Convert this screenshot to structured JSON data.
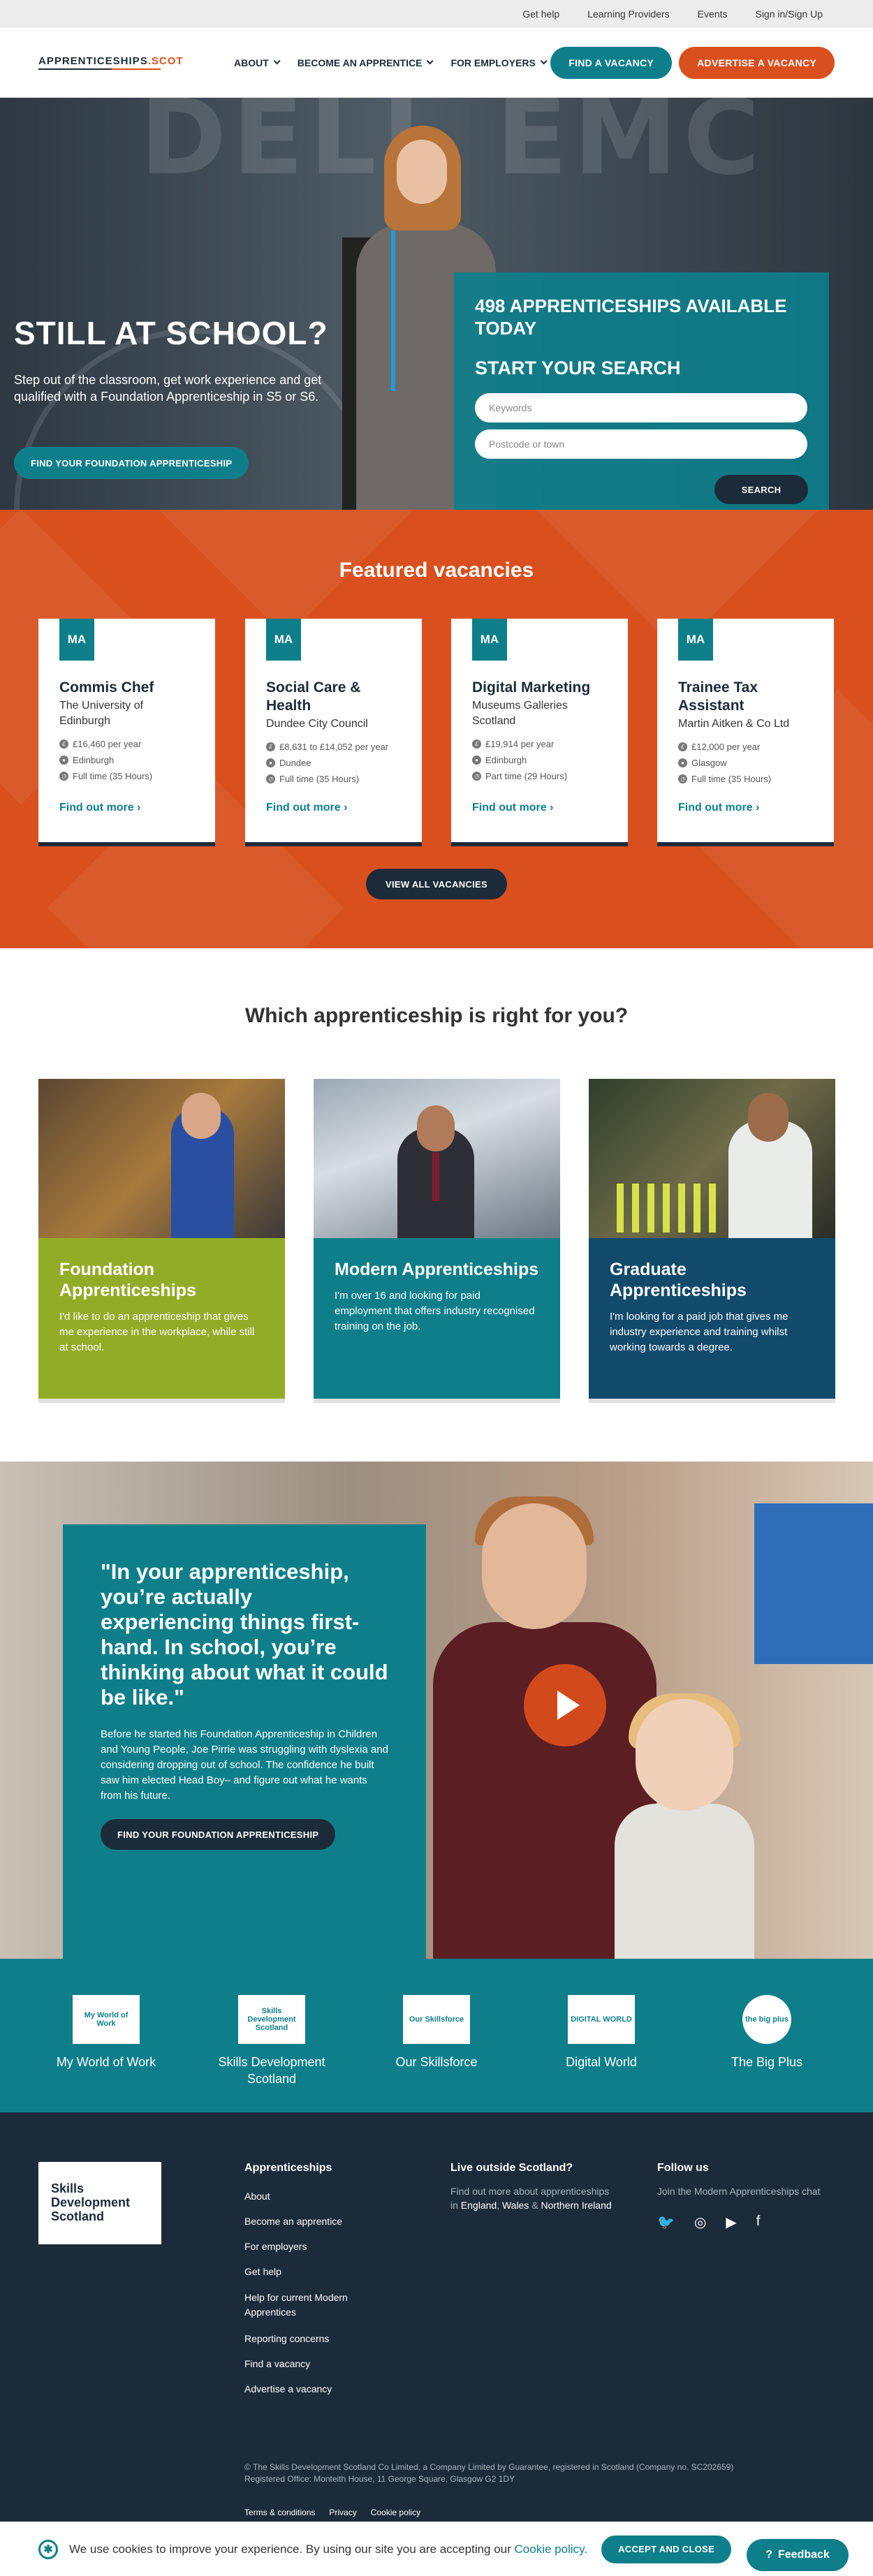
{
  "util_nav": [
    "Get help",
    "Learning Providers",
    "Events",
    "Sign in/Sign Up"
  ],
  "logo": {
    "main_a": "APPRENTICESHIPS",
    "main_b": ".SCOT"
  },
  "nav": [
    "About",
    "Become an apprentice",
    "For employers"
  ],
  "header_buttons": {
    "find": "FIND A VACANCY",
    "advertise": "ADVERTISE A VACANCY"
  },
  "hero": {
    "bg_text": "DELL EMC",
    "title": "STILL AT SCHOOL?",
    "subtitle": "Step out of the classroom, get work experience and get qualified with a Foundation Apprenticeship in S5 or S6.",
    "cta": "FIND YOUR FOUNDATION APPRENTICESHIP"
  },
  "search": {
    "count_text": "498 APPRENTICESHIPS AVAILABLE TODAY",
    "heading": "START YOUR SEARCH",
    "keywords_placeholder": "Keywords",
    "postcode_placeholder": "Postcode or town",
    "button": "SEARCH"
  },
  "featured": {
    "heading": "Featured vacancies",
    "badge": "MA",
    "more": "Find out more ›",
    "view_all": "VIEW ALL VACANCIES",
    "items": [
      {
        "title": "Commis Chef",
        "org": "The University of Edinburgh",
        "pay": "£16,460 per year",
        "location": "Edinburgh",
        "hours": "Full time (35 Hours)"
      },
      {
        "title": "Social Care & Health",
        "org": "Dundee City Council",
        "pay": "£8,631 to £14,052 per year",
        "location": "Dundee",
        "hours": "Full time (35 Hours)"
      },
      {
        "title": "Digital Marketing",
        "org": "Museums Galleries Scotland",
        "pay": "£19,914 per year",
        "location": "Edinburgh",
        "hours": "Part time (29 Hours)"
      },
      {
        "title": "Trainee Tax Assistant",
        "org": "Martin Aitken & Co Ltd",
        "pay": "£12,000 per year",
        "location": "Glasgow",
        "hours": "Full time (35 Hours)"
      }
    ]
  },
  "which": {
    "heading": "Which apprenticeship is right for you?",
    "cards": [
      {
        "title": "Foundation Apprenticeships",
        "text": "I'd like to do an apprenticeship that gives me experience in the workplace, while still at school.",
        "color": "#93ac27"
      },
      {
        "title": "Modern Apprenticeships",
        "text": "I'm over 16 and looking for paid employment that offers industry recognised training on the job.",
        "color": "#0e7f8a"
      },
      {
        "title": "Graduate Apprenticeships",
        "text": "I'm looking for a paid job that gives me industry experience and training whilst working towards a degree.",
        "color": "#124a6b"
      }
    ]
  },
  "quote": {
    "text": "\"In your apprenticeship, you’re actually experiencing things first-hand. In school, you’re thinking about what it could be like.\"",
    "body": "Before he started his Foundation Apprenticeship in Children and Young People, Joe Pirrie was struggling with dyslexia and considering dropping out of school. The confidence he built saw him elected Head Boy– and figure out what he wants from his future.",
    "cta": "FIND YOUR FOUNDATION APPRENTICESHIP"
  },
  "partners": [
    {
      "label": "My World of Work",
      "logo": "My World of Work"
    },
    {
      "label": "Skills Development Scotland",
      "logo": "Skills Development Scotland"
    },
    {
      "label": "Our Skillsforce",
      "logo": "Our Skillsforce"
    },
    {
      "label": "Digital World",
      "logo": "DIGITAL WORLD"
    },
    {
      "label": "The Big Plus",
      "logo": "the big plus"
    }
  ],
  "footer": {
    "logo": "Skills Development Scotland",
    "col1_title": "Apprenticeships",
    "col1_links": [
      "About",
      "Become an apprentice",
      "For employers",
      "Get help",
      "Help for current Modern Apprentices",
      "Reporting concerns",
      "Find a vacancy",
      "Advertise a vacancy"
    ],
    "col2_title": "Live outside Scotland?",
    "col2_text_a": "Find out more about apprenticeships in ",
    "col2_links": [
      "England",
      "Wales",
      "Northern Ireland"
    ],
    "col3_title": "Follow us",
    "col3_text": "Join the Modern Apprenticeships chat",
    "social_icons": [
      "twitter-icon",
      "instagram-icon",
      "youtube-icon",
      "facebook-icon"
    ],
    "copyright": "© The Skills Development Scotland Co Limited, a Company Limited by Guarantee, registered in Scotland (Company no. SC202659) Registered Office: Monteith House, 11 George Square, Glasgow G2 1DY",
    "legal": [
      "Terms & conditions",
      "Privacy",
      "Cookie policy"
    ]
  },
  "cookie": {
    "text": "We use cookies to improve your experience. By using our site you are accepting our ",
    "link": "Cookie policy.",
    "button": "ACCEPT AND CLOSE"
  },
  "feedback": "Feedback"
}
